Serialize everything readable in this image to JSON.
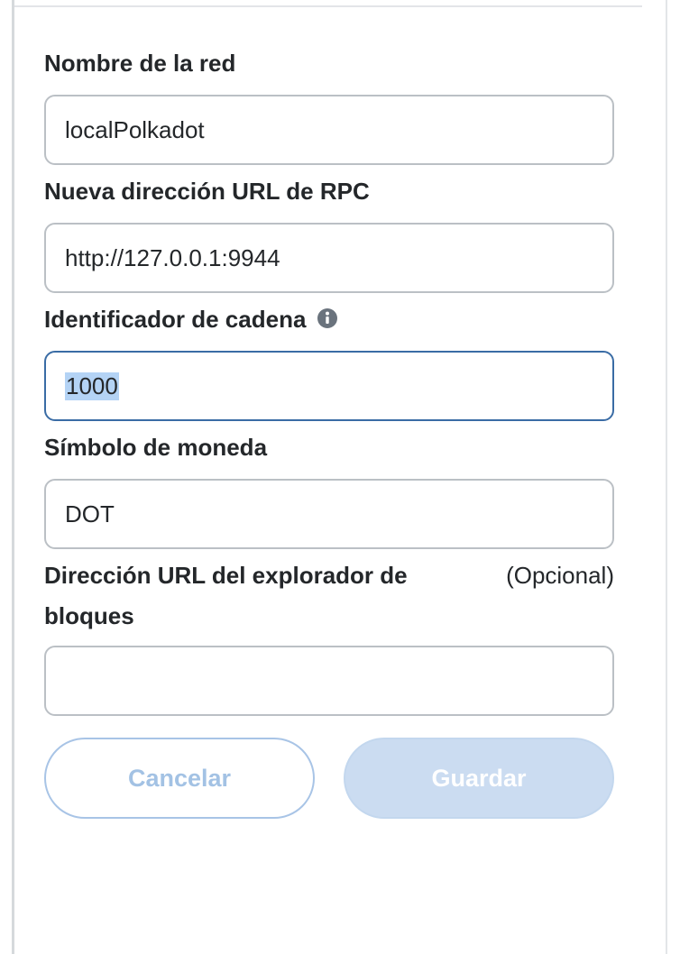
{
  "form": {
    "network_name": {
      "label": "Nombre de la red",
      "value": "localPolkadot"
    },
    "rpc_url": {
      "label": "Nueva dirección URL de RPC",
      "value": "http://127.0.0.1:9944"
    },
    "chain_id": {
      "label": "Identificador de cadena",
      "value": "1000",
      "icon": "info-icon"
    },
    "currency_symbol": {
      "label": "Símbolo de moneda",
      "value": "DOT"
    },
    "block_explorer": {
      "label": "Dirección URL del explorador de bloques",
      "optional_label": "(Opcional)",
      "value": ""
    }
  },
  "buttons": {
    "cancel_label": "Cancelar",
    "save_label": "Guardar"
  },
  "colors": {
    "focus_border": "#3a6ca5",
    "button_text_disabled": "#a3c2e4",
    "save_bg_disabled": "#cbdcf1"
  }
}
